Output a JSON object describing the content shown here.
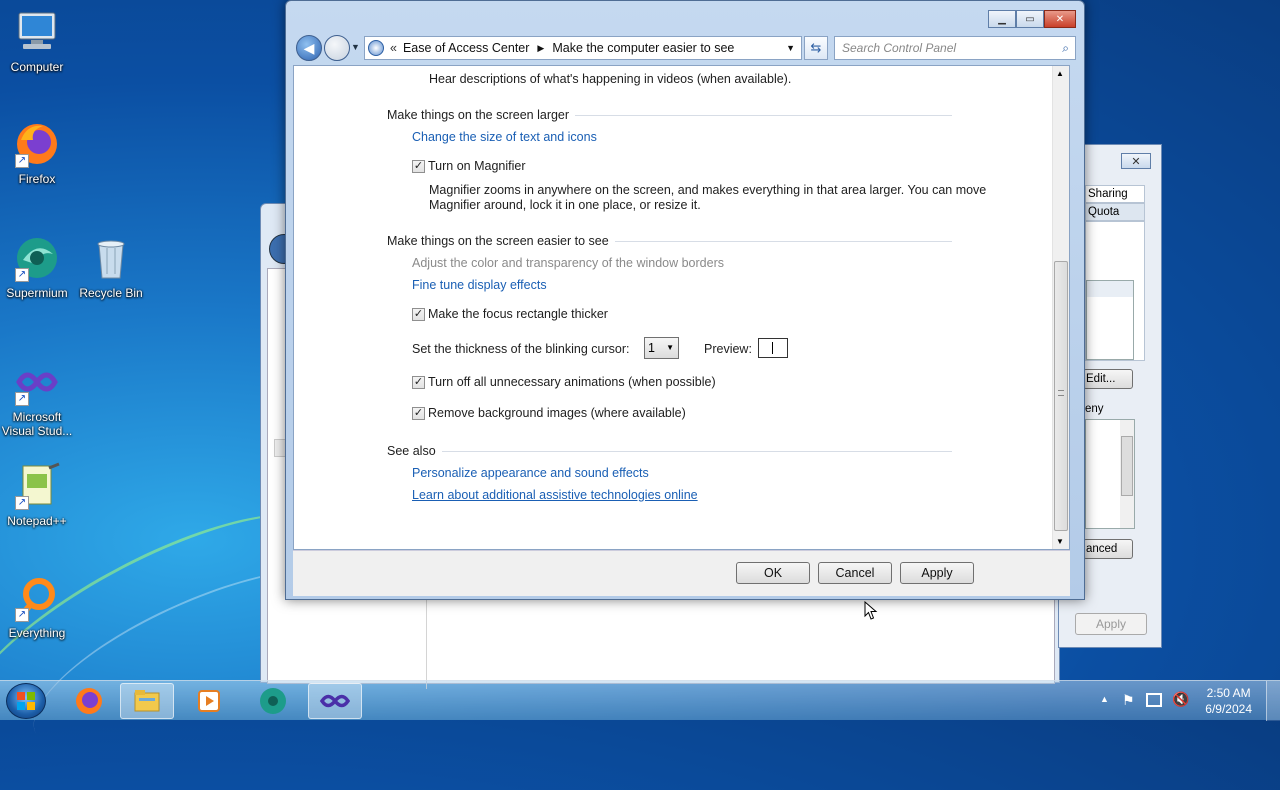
{
  "desktop": {
    "icons": [
      {
        "label": "Computer"
      },
      {
        "label": "Firefox"
      },
      {
        "label": "Supermium"
      },
      {
        "label": "Recycle Bin"
      },
      {
        "label": "Microsoft Visual Stud..."
      },
      {
        "label": "Notepad++"
      },
      {
        "label": "Everything"
      }
    ]
  },
  "bg_window": {
    "tabs": [
      "Sharing",
      "Quota"
    ],
    "edit_button": "Edit...",
    "deny_label": "eny",
    "advanced_button": "anced",
    "apply_button": "Apply"
  },
  "window": {
    "breadcrumb": [
      "Ease of Access Center",
      "Make the computer easier to see"
    ],
    "search_placeholder": "Search Control Panel",
    "top_text": "Hear descriptions of what's happening in videos (when available).",
    "section1": {
      "heading": "Make things on the screen larger",
      "link": "Change the size of text and icons",
      "magnifier_label": "Turn on Magnifier",
      "magnifier_checked": true,
      "magnifier_desc_1": "Magnifier zooms in anywhere on the screen, and makes everything in that area larger. You can move",
      "magnifier_desc_2": "Magnifier around, lock it in one place, or resize it."
    },
    "section2": {
      "heading": "Make things on the screen easier to see",
      "disabled_link": "Adjust the color and transparency of the window borders",
      "link": "Fine tune display effects",
      "focus_label": "Make the focus rectangle thicker",
      "focus_checked": true,
      "cursor_label": "Set the thickness of the blinking cursor:",
      "cursor_value": "1",
      "preview_label": "Preview:",
      "animations_label": "Turn off all unnecessary animations (when possible)",
      "animations_checked": true,
      "bgimages_label": "Remove background images (where available)",
      "bgimages_checked": true
    },
    "see_also": {
      "heading": "See also",
      "link1": "Personalize appearance and sound effects",
      "link2": "Learn about additional assistive technologies online"
    },
    "buttons": {
      "ok": "OK",
      "cancel": "Cancel",
      "apply": "Apply"
    }
  },
  "taskbar": {
    "time": "2:50 AM",
    "date": "6/9/2024"
  },
  "colors": {
    "link": "#1a5fb4",
    "accent": "#2d5fa3"
  }
}
